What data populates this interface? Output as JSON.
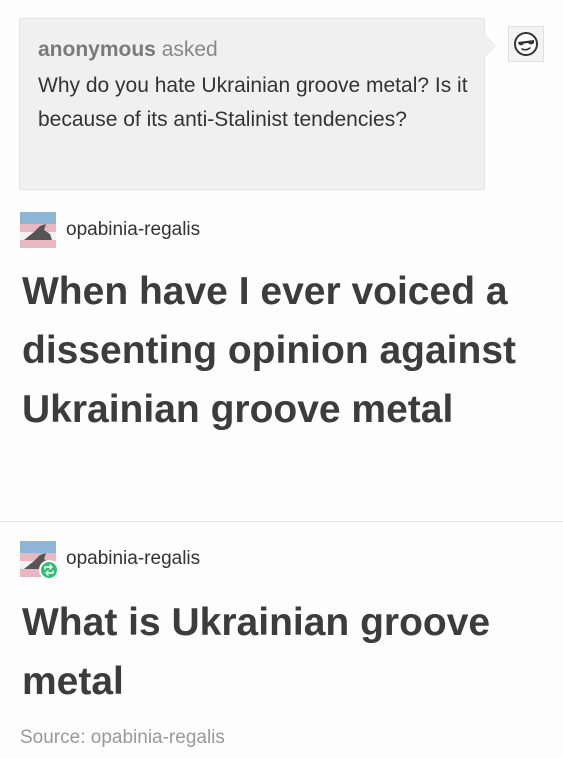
{
  "ask": {
    "asker": "anonymous",
    "verb": "asked",
    "question": "Why do you hate Ukrainian groove metal? Is it because of its anti-Stalinist tendencies?"
  },
  "icons": {
    "anon_avatar": "anonymous-sunglasses-icon",
    "user_avatar": "opabinia-avatar-icon",
    "reblog": "reblog-icon"
  },
  "posts": [
    {
      "username": "opabinia-regalis",
      "text": "When have I ever voiced a dissenting opinion against Ukrainian groove metal"
    },
    {
      "username": "opabinia-regalis",
      "text": "What is Ukrainian groove metal"
    }
  ],
  "source": {
    "label": "Source: opabinia-regalis"
  },
  "colors": {
    "ask_background": "#f0f0f0",
    "reblog_badge": "#2fbf71",
    "text": "#3c3c3c",
    "muted": "#999999"
  }
}
